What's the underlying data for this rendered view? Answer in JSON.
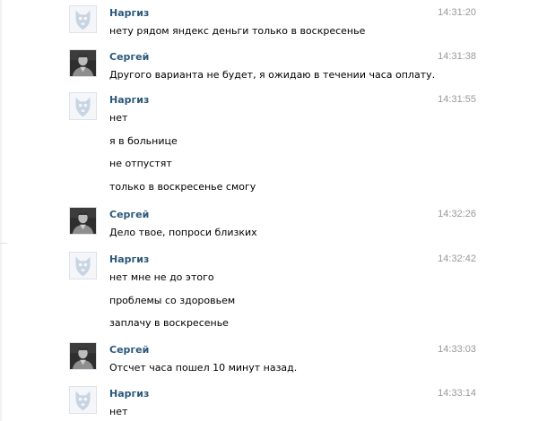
{
  "messages": [
    {
      "author": "Наргиз",
      "avatar": "vk-dog-placeholder-icon",
      "time": "14:31:20",
      "lines": [
        "нету рядом яндекс деньги только в воскресенье"
      ]
    },
    {
      "author": "Сергей",
      "avatar": "user-photo-avatar",
      "time": "14:31:38",
      "lines": [
        "Другого варианта не будет, я ожидаю в течении часа оплату."
      ]
    },
    {
      "author": "Наргиз",
      "avatar": "vk-dog-placeholder-icon",
      "time": "14:31:55",
      "lines": [
        "нет",
        "я в больнице",
        "не отпустят",
        "только в воскресенье смогу"
      ]
    },
    {
      "author": "Сергей",
      "avatar": "user-photo-avatar",
      "time": "14:32:26",
      "lines": [
        "Дело твое, попроси близких"
      ]
    },
    {
      "author": "Наргиз",
      "avatar": "vk-dog-placeholder-icon",
      "time": "14:32:42",
      "lines": [
        "нет мне не до этого",
        "проблемы со здоровьем",
        "заплачу в воскресенье"
      ]
    },
    {
      "author": "Сергей",
      "avatar": "user-photo-avatar",
      "time": "14:33:03",
      "lines": [
        "Отсчет часа пошел 10 минут назад."
      ]
    },
    {
      "author": "Наргиз",
      "avatar": "vk-dog-placeholder-icon",
      "time": "14:33:14",
      "lines": [
        "нет"
      ]
    }
  ]
}
